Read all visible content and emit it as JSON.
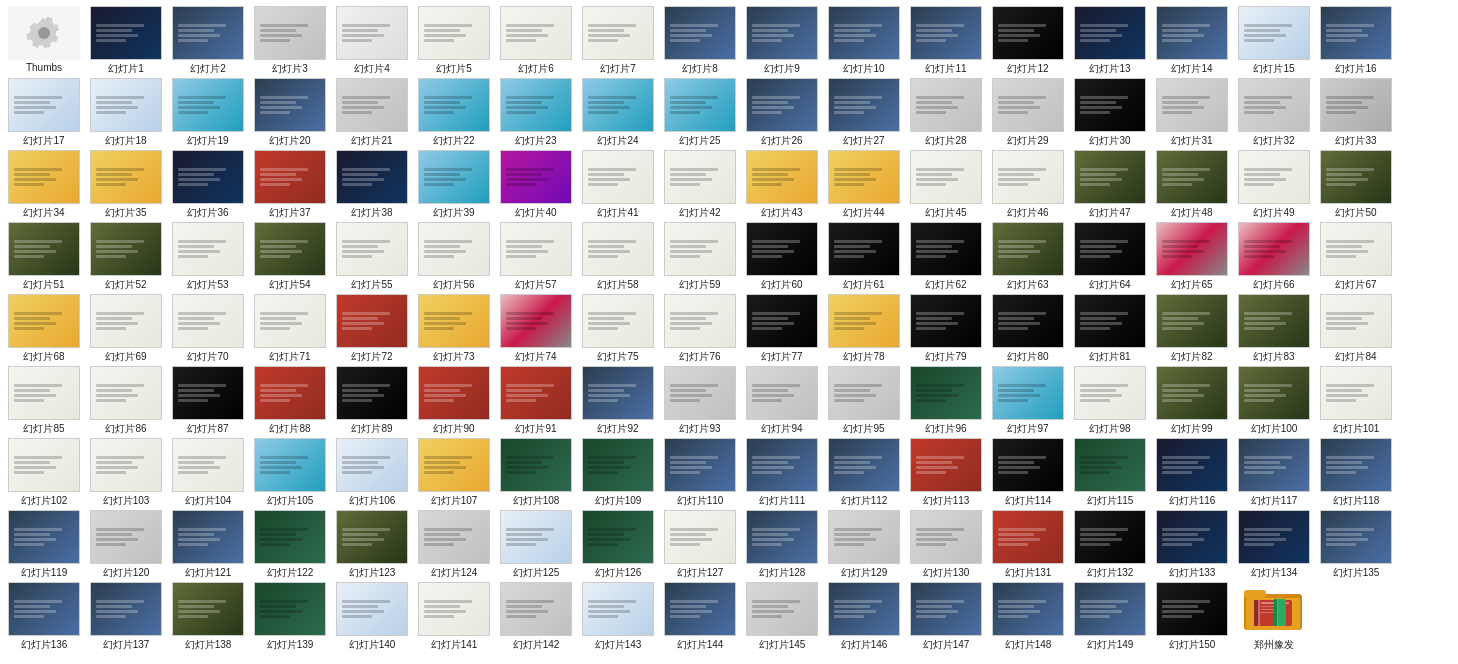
{
  "thumbs_label": "Thumbs",
  "slides": [
    {
      "id": 1,
      "label": "幻灯片1",
      "color": 1
    },
    {
      "id": 2,
      "label": "幻灯片2",
      "color": 2
    },
    {
      "id": 3,
      "label": "幻灯片3",
      "color": 3
    },
    {
      "id": 4,
      "label": "幻灯片4",
      "color": 17
    },
    {
      "id": 5,
      "label": "幻灯片5",
      "color": 4
    },
    {
      "id": 6,
      "label": "幻灯片6",
      "color": 4
    },
    {
      "id": 7,
      "label": "幻灯片7",
      "color": 4
    },
    {
      "id": 8,
      "label": "幻灯片8",
      "color": 2
    },
    {
      "id": 9,
      "label": "幻灯片9",
      "color": 2
    },
    {
      "id": 10,
      "label": "幻灯片10",
      "color": 2
    },
    {
      "id": 11,
      "label": "幻灯片11",
      "color": 2
    },
    {
      "id": 12,
      "label": "幻灯片12",
      "color": 8
    },
    {
      "id": 13,
      "label": "幻灯片13",
      "color": 1
    },
    {
      "id": 14,
      "label": "幻灯片14",
      "color": 2
    },
    {
      "id": 15,
      "label": "幻灯片15",
      "color": 16
    },
    {
      "id": 16,
      "label": "幻灯片16",
      "color": 2
    },
    {
      "id": 17,
      "label": "幻灯片17",
      "color": 16
    },
    {
      "id": 18,
      "label": "幻灯片18",
      "color": 16
    },
    {
      "id": 19,
      "label": "幻灯片19",
      "color": 14
    },
    {
      "id": 20,
      "label": "幻灯片20",
      "color": 2
    },
    {
      "id": 21,
      "label": "幻灯片21",
      "color": 3
    },
    {
      "id": 22,
      "label": "幻灯片22",
      "color": 14
    },
    {
      "id": 23,
      "label": "幻灯片23",
      "color": 14
    },
    {
      "id": 24,
      "label": "幻灯片24",
      "color": 14
    },
    {
      "id": 25,
      "label": "幻灯片25",
      "color": 14
    },
    {
      "id": 26,
      "label": "幻灯片26",
      "color": 2
    },
    {
      "id": 27,
      "label": "幻灯片27",
      "color": 2
    },
    {
      "id": 28,
      "label": "幻灯片28",
      "color": 3
    },
    {
      "id": 29,
      "label": "幻灯片29",
      "color": 3
    },
    {
      "id": 30,
      "label": "幻灯片30",
      "color": 8
    },
    {
      "id": 31,
      "label": "幻灯片31",
      "color": 3
    },
    {
      "id": 32,
      "label": "幻灯片32",
      "color": 3
    },
    {
      "id": 33,
      "label": "幻灯片33",
      "color": 13
    },
    {
      "id": 34,
      "label": "幻灯片34",
      "color": 11
    },
    {
      "id": 35,
      "label": "幻灯片35",
      "color": 11
    },
    {
      "id": 36,
      "label": "幻灯片36",
      "color": 1
    },
    {
      "id": 37,
      "label": "幻灯片37",
      "color": 9
    },
    {
      "id": 38,
      "label": "幻灯片38",
      "color": 1
    },
    {
      "id": 39,
      "label": "幻灯片39",
      "color": 14
    },
    {
      "id": 40,
      "label": "幻灯片40",
      "color": 6
    },
    {
      "id": 41,
      "label": "幻灯片41",
      "color": 4
    },
    {
      "id": 42,
      "label": "幻灯片42",
      "color": 4
    },
    {
      "id": 43,
      "label": "幻灯片43",
      "color": 11
    },
    {
      "id": 44,
      "label": "幻灯片44",
      "color": 11
    },
    {
      "id": 45,
      "label": "幻灯片45",
      "color": 4
    },
    {
      "id": 46,
      "label": "幻灯片46",
      "color": 4
    },
    {
      "id": 47,
      "label": "幻灯片47",
      "color": 10
    },
    {
      "id": 48,
      "label": "幻灯片48",
      "color": 10
    },
    {
      "id": 49,
      "label": "幻灯片49",
      "color": 4
    },
    {
      "id": 50,
      "label": "幻灯片50",
      "color": 10
    },
    {
      "id": 51,
      "label": "幻灯片51",
      "color": 10
    },
    {
      "id": 52,
      "label": "幻灯片52",
      "color": 10
    },
    {
      "id": 53,
      "label": "幻灯片53",
      "color": 4
    },
    {
      "id": 54,
      "label": "幻灯片54",
      "color": 10
    },
    {
      "id": 55,
      "label": "幻灯片55",
      "color": 4
    },
    {
      "id": 56,
      "label": "幻灯片56",
      "color": 4
    },
    {
      "id": 57,
      "label": "幻灯片57",
      "color": 4
    },
    {
      "id": 58,
      "label": "幻灯片58",
      "color": 4
    },
    {
      "id": 59,
      "label": "幻灯片59",
      "color": 4
    },
    {
      "id": 60,
      "label": "幻灯片60",
      "color": 8
    },
    {
      "id": 61,
      "label": "幻灯片61",
      "color": 8
    },
    {
      "id": 62,
      "label": "幻灯片62",
      "color": 8
    },
    {
      "id": 63,
      "label": "幻灯片63",
      "color": 10
    },
    {
      "id": 64,
      "label": "幻灯片64",
      "color": 8
    },
    {
      "id": 65,
      "label": "幻灯片65",
      "color": 15
    },
    {
      "id": 66,
      "label": "幻灯片66",
      "color": 15
    },
    {
      "id": 67,
      "label": "幻灯片67",
      "color": 4
    },
    {
      "id": 68,
      "label": "幻灯片68",
      "color": 11
    },
    {
      "id": 69,
      "label": "幻灯片69",
      "color": 4
    },
    {
      "id": 70,
      "label": "幻灯片70",
      "color": 4
    },
    {
      "id": 71,
      "label": "幻灯片71",
      "color": 4
    },
    {
      "id": 72,
      "label": "幻灯片72",
      "color": 9
    },
    {
      "id": 73,
      "label": "幻灯片73",
      "color": 11
    },
    {
      "id": 74,
      "label": "幻灯片74",
      "color": 15
    },
    {
      "id": 75,
      "label": "幻灯片75",
      "color": 4
    },
    {
      "id": 76,
      "label": "幻灯片76",
      "color": 4
    },
    {
      "id": 77,
      "label": "幻灯片77",
      "color": 8
    },
    {
      "id": 78,
      "label": "幻灯片78",
      "color": 11
    },
    {
      "id": 79,
      "label": "幻灯片79",
      "color": 8
    },
    {
      "id": 80,
      "label": "幻灯片80",
      "color": 8
    },
    {
      "id": 81,
      "label": "幻灯片81",
      "color": 8
    },
    {
      "id": 82,
      "label": "幻灯片82",
      "color": 10
    },
    {
      "id": 83,
      "label": "幻灯片83",
      "color": 10
    },
    {
      "id": 84,
      "label": "幻灯片84",
      "color": 4
    },
    {
      "id": 85,
      "label": "幻灯片85",
      "color": 4
    },
    {
      "id": 86,
      "label": "幻灯片86",
      "color": 4
    },
    {
      "id": 87,
      "label": "幻灯片87",
      "color": 8
    },
    {
      "id": 88,
      "label": "幻灯片88",
      "color": 9
    },
    {
      "id": 89,
      "label": "幻灯片89",
      "color": 8
    },
    {
      "id": 90,
      "label": "幻灯片90",
      "color": 9
    },
    {
      "id": 91,
      "label": "幻灯片91",
      "color": 9
    },
    {
      "id": 92,
      "label": "幻灯片92",
      "color": 2
    },
    {
      "id": 93,
      "label": "幻灯片93",
      "color": 3
    },
    {
      "id": 94,
      "label": "幻灯片94",
      "color": 3
    },
    {
      "id": 95,
      "label": "幻灯片95",
      "color": 3
    },
    {
      "id": 96,
      "label": "幻灯片96",
      "color": 5
    },
    {
      "id": 97,
      "label": "幻灯片97",
      "color": 14
    },
    {
      "id": 98,
      "label": "幻灯片98",
      "color": 4
    },
    {
      "id": 99,
      "label": "幻灯片99",
      "color": 10
    },
    {
      "id": 100,
      "label": "幻灯片100",
      "color": 10
    },
    {
      "id": 101,
      "label": "幻灯片101",
      "color": 4
    },
    {
      "id": 102,
      "label": "幻灯片102",
      "color": 4
    },
    {
      "id": 103,
      "label": "幻灯片103",
      "color": 4
    },
    {
      "id": 104,
      "label": "幻灯片104",
      "color": 4
    },
    {
      "id": 105,
      "label": "幻灯片105",
      "color": 14
    },
    {
      "id": 106,
      "label": "幻灯片106",
      "color": 16
    },
    {
      "id": 107,
      "label": "幻灯片107",
      "color": 11
    },
    {
      "id": 108,
      "label": "幻灯片108",
      "color": 5
    },
    {
      "id": 109,
      "label": "幻灯片109",
      "color": 5
    },
    {
      "id": 110,
      "label": "幻灯片110",
      "color": 2
    },
    {
      "id": 111,
      "label": "幻灯片111",
      "color": 2
    },
    {
      "id": 112,
      "label": "幻灯片112",
      "color": 2
    },
    {
      "id": 113,
      "label": "幻灯片113",
      "color": 9
    },
    {
      "id": 114,
      "label": "幻灯片114",
      "color": 8
    },
    {
      "id": 115,
      "label": "幻灯片115",
      "color": 5
    },
    {
      "id": 116,
      "label": "幻灯片116",
      "color": 1
    },
    {
      "id": 117,
      "label": "幻灯片117",
      "color": 2
    },
    {
      "id": 118,
      "label": "幻灯片118",
      "color": 2
    },
    {
      "id": 119,
      "label": "幻灯片119",
      "color": 2
    },
    {
      "id": 120,
      "label": "幻灯片120",
      "color": 3
    },
    {
      "id": 121,
      "label": "幻灯片121",
      "color": 2
    },
    {
      "id": 122,
      "label": "幻灯片122",
      "color": 5
    },
    {
      "id": 123,
      "label": "幻灯片123",
      "color": 10
    },
    {
      "id": 124,
      "label": "幻灯片124",
      "color": 3
    },
    {
      "id": 125,
      "label": "幻灯片125",
      "color": 16
    },
    {
      "id": 126,
      "label": "幻灯片126",
      "color": 5
    },
    {
      "id": 127,
      "label": "幻灯片127",
      "color": 4
    },
    {
      "id": 128,
      "label": "幻灯片128",
      "color": 2
    },
    {
      "id": 129,
      "label": "幻灯片129",
      "color": 3
    },
    {
      "id": 130,
      "label": "幻灯片130",
      "color": 3
    },
    {
      "id": 131,
      "label": "幻灯片131",
      "color": 9
    },
    {
      "id": 132,
      "label": "幻灯片132",
      "color": 8
    },
    {
      "id": 133,
      "label": "幻灯片133",
      "color": 1
    },
    {
      "id": 134,
      "label": "幻灯片134",
      "color": 1
    },
    {
      "id": 135,
      "label": "幻灯片135",
      "color": 2
    },
    {
      "id": 136,
      "label": "幻灯片136",
      "color": 2
    },
    {
      "id": 137,
      "label": "幻灯片137",
      "color": 2
    },
    {
      "id": 138,
      "label": "幻灯片138",
      "color": 10
    },
    {
      "id": 139,
      "label": "幻灯片139",
      "color": 5
    },
    {
      "id": 140,
      "label": "幻灯片140",
      "color": 16
    },
    {
      "id": 141,
      "label": "幻灯片141",
      "color": 4
    },
    {
      "id": 142,
      "label": "幻灯片142",
      "color": 3
    },
    {
      "id": 143,
      "label": "幻灯片143",
      "color": 16
    },
    {
      "id": 144,
      "label": "幻灯片144",
      "color": 2
    },
    {
      "id": 145,
      "label": "幻灯片145",
      "color": 3
    },
    {
      "id": 146,
      "label": "幻灯片146",
      "color": 2
    },
    {
      "id": 147,
      "label": "幻灯片147",
      "color": 2
    },
    {
      "id": 148,
      "label": "幻灯片148",
      "color": 2
    },
    {
      "id": 149,
      "label": "幻灯片149",
      "color": 2
    },
    {
      "id": 150,
      "label": "幻灯片150",
      "color": 8
    }
  ],
  "special_folder": {
    "label": "郑州豫发",
    "color": "#e8a020"
  }
}
